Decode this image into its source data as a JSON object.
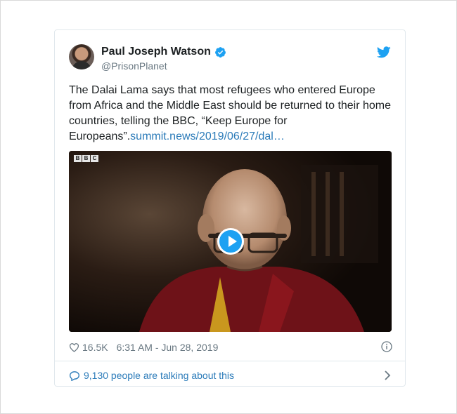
{
  "tweet": {
    "author_name": "Paul Joseph Watson",
    "author_handle": "@PrisonPlanet",
    "body_text": "The Dalai Lama says that most refugees who entered Europe from Africa and the Middle East should be returned to their home countries, telling the BBC, “Keep Europe for Europeans”.",
    "link_text": "summit.news/2019/06/27/dal…",
    "likes": "16.5K",
    "timestamp": "6:31 AM - Jun 28, 2019",
    "talking": "9,130 people are talking about this"
  },
  "media": {
    "watermark": [
      "B",
      "B",
      "C"
    ]
  },
  "icons": {
    "verified": "verified-badge-icon",
    "bird": "twitter-bird-icon",
    "heart": "heart-icon",
    "info": "info-icon",
    "bubble": "comment-bubble-icon",
    "chevron": "chevron-right-icon",
    "play": "play-icon"
  },
  "colors": {
    "accent": "#1da1f2",
    "link": "#2b7bb9",
    "text": "#1c2022",
    "muted": "#697882",
    "border": "#e1e8ed"
  }
}
